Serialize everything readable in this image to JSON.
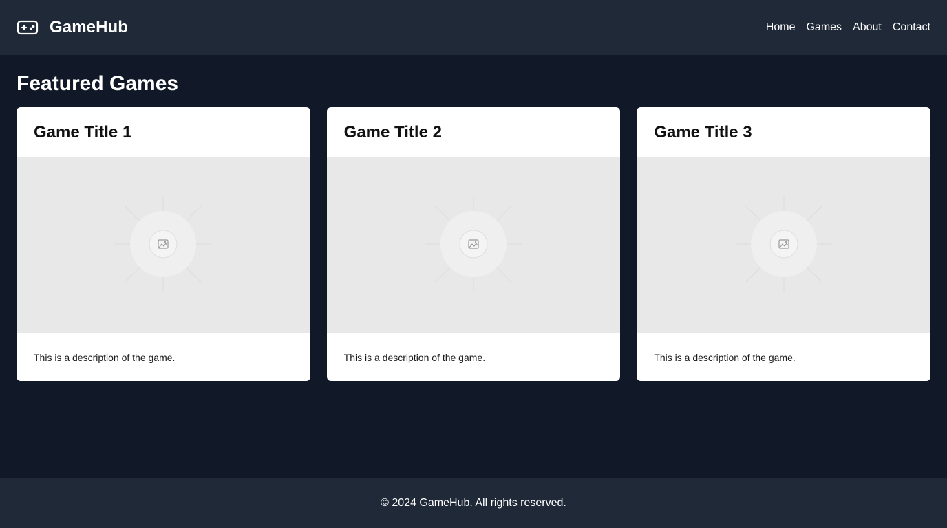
{
  "header": {
    "logo_icon": "gamepad-icon",
    "brand": "GameHub",
    "nav": [
      {
        "label": "Home"
      },
      {
        "label": "Games"
      },
      {
        "label": "About"
      },
      {
        "label": "Contact"
      }
    ]
  },
  "main": {
    "title": "Featured Games",
    "cards": [
      {
        "title": "Game Title 1",
        "image_icon": "image-placeholder-icon",
        "description": "This is a description of the game."
      },
      {
        "title": "Game Title 2",
        "image_icon": "image-placeholder-icon",
        "description": "This is a description of the game."
      },
      {
        "title": "Game Title 3",
        "image_icon": "image-placeholder-icon",
        "description": "This is a description of the game."
      }
    ]
  },
  "footer": {
    "text": "© 2024 GameHub. All rights reserved."
  },
  "colors": {
    "page_bg": "#111827",
    "header_bg": "#1f2937",
    "footer_bg": "#1f2937",
    "card_bg": "#ffffff",
    "image_bg": "#e8e8e8"
  }
}
